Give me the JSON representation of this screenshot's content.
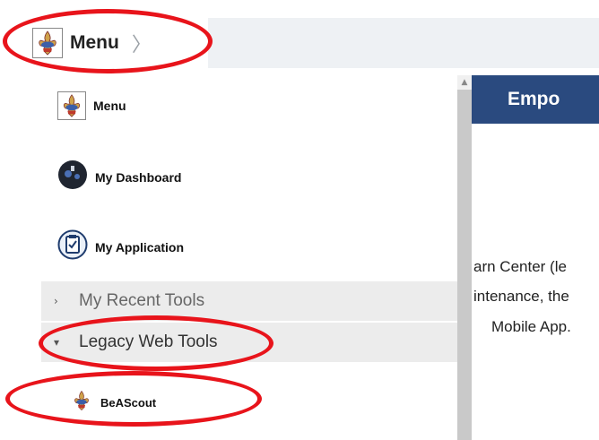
{
  "header": {
    "menu_label": "Menu",
    "chevron": "〉"
  },
  "sidebar": {
    "items": [
      {
        "label": "Menu",
        "icon": "bsa-fleur-icon"
      },
      {
        "label": "My Dashboard",
        "icon": "dashboard-globe-icon"
      },
      {
        "label": "My Application",
        "icon": "clipboard-check-icon"
      }
    ],
    "sections": [
      {
        "label": "My Recent Tools",
        "arrow": "›",
        "state": "collapsed"
      },
      {
        "label": "Legacy Web Tools",
        "arrow": "▾",
        "state": "expanded"
      }
    ],
    "subitems": [
      {
        "label": "BeAScout",
        "icon": "bsa-fleur-icon"
      }
    ]
  },
  "main": {
    "banner_title": "Empo",
    "lines": [
      "arn Center (le",
      "intenance, the",
      "Mobile App."
    ]
  },
  "scrollbar": {
    "up_arrow": "▲"
  },
  "colors": {
    "banner": "#2a4a7f",
    "annotation": "#e8141b",
    "section_bg": "#ececec"
  }
}
